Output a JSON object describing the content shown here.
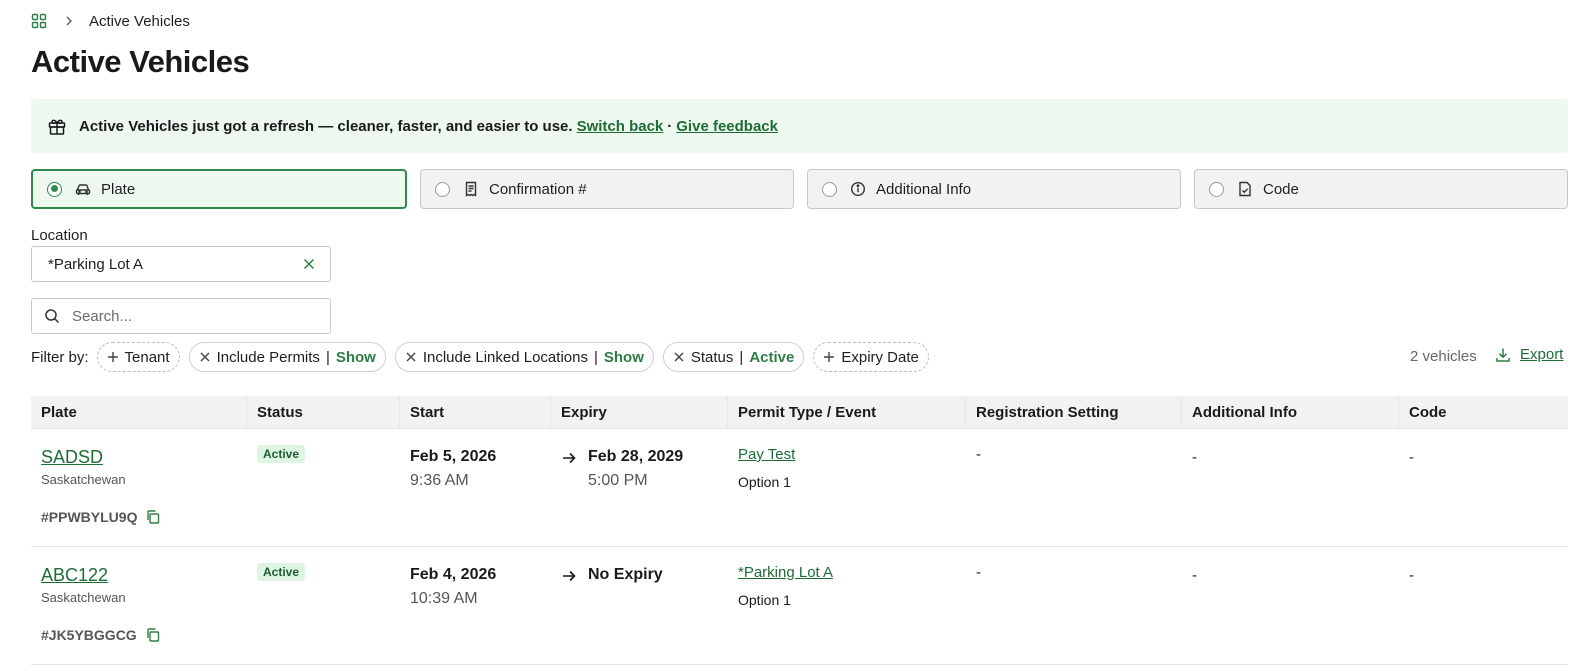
{
  "breadcrumb": {
    "current": "Active Vehicles"
  },
  "page_title": "Active Vehicles",
  "banner": {
    "message": "Active Vehicles just got a refresh — cleaner, faster, and easier to use.",
    "switch_back": "Switch back",
    "separator": "·",
    "give_feedback": "Give feedback"
  },
  "modes": [
    {
      "label": "Plate",
      "icon": "car-icon",
      "selected": true
    },
    {
      "label": "Confirmation #",
      "icon": "receipt-icon",
      "selected": false
    },
    {
      "label": "Additional Info",
      "icon": "info-icon",
      "selected": false
    },
    {
      "label": "Code",
      "icon": "code-doc-icon",
      "selected": false
    }
  ],
  "location": {
    "label": "Location",
    "value": "*Parking Lot A"
  },
  "search": {
    "placeholder": "Search..."
  },
  "filters": {
    "label": "Filter by:",
    "tenant": "Tenant",
    "include_permits": {
      "label": "Include Permits",
      "value": "Show"
    },
    "include_linked": {
      "label": "Include Linked Locations",
      "value": "Show"
    },
    "status": {
      "label": "Status",
      "value": "Active"
    },
    "expiry": "Expiry Date"
  },
  "count": "2 vehicles",
  "export": "Export",
  "table": {
    "headers": [
      "Plate",
      "Status",
      "Start",
      "Expiry",
      "Permit Type / Event",
      "Registration Setting",
      "Additional Info",
      "Code"
    ],
    "rows": [
      {
        "plate": "SADSD",
        "province": "Saskatchewan",
        "confirmation": "#PPWBYLU9Q",
        "status": "Active",
        "start_date": "Feb 5, 2026",
        "start_time": "9:36 AM",
        "expiry_date": "Feb 28, 2029",
        "expiry_time": "5:00 PM",
        "permit": "Pay Test",
        "option": "Option 1",
        "registration": "-",
        "additional": "-",
        "code": "-"
      },
      {
        "plate": "ABC122",
        "province": "Saskatchewan",
        "confirmation": "#JK5YBGGCG",
        "status": "Active",
        "start_date": "Feb 4, 2026",
        "start_time": "10:39 AM",
        "expiry_date": "No Expiry",
        "expiry_time": "",
        "permit": "*Parking Lot A",
        "option": "Option 1",
        "registration": "-",
        "additional": "-",
        "code": "-"
      }
    ]
  },
  "colors": {
    "accent": "#2e7d46",
    "banner_bg": "#edf9ef",
    "badge_bg": "#dff5e3"
  }
}
